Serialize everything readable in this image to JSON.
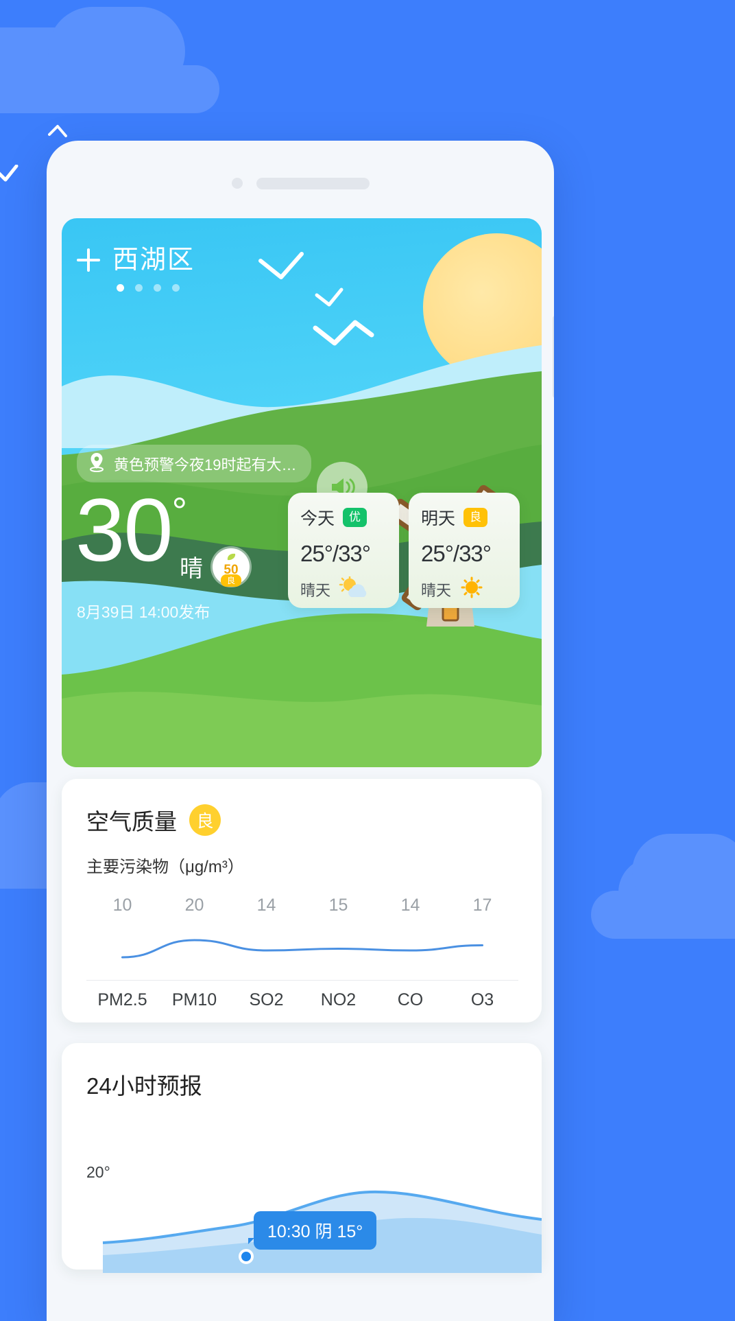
{
  "background": {
    "brand_blue": "#3d7efc",
    "cloud_blue": "#5a91fd"
  },
  "hero": {
    "add_icon": "plus-icon",
    "city": "西湖区",
    "page_dots": 4,
    "active_dot": 0,
    "voice_icon": "speaker-bubble-icon",
    "alert": {
      "icon": "location-pin-icon",
      "text": "黄色预警今夜19时起有大…"
    },
    "temperature": "30",
    "degree": "°",
    "condition": "晴",
    "aqi_badge": {
      "value": "50",
      "level": "良",
      "leaf_icon": "leaf-icon",
      "value_color": "#f0a500",
      "level_bg": "#ffc107"
    },
    "publish": "8月39日 14:00发布",
    "windmill_icon": "windmill-icon",
    "sun_icon": "sun-icon"
  },
  "forecast_cards": [
    {
      "day": "今天",
      "badge": "优",
      "badge_color": "#14c26a",
      "temp": "25°/33°",
      "desc": "晴天",
      "icon": "sun-behind-cloud-icon"
    },
    {
      "day": "明天",
      "badge": "良",
      "badge_color": "#ffc107",
      "temp": "25°/33°",
      "desc": "晴天",
      "icon": "sun-icon"
    }
  ],
  "air_quality": {
    "title": "空气质量",
    "level": "良",
    "level_color": "#ffd02e",
    "subtitle": "主要污染物（μg/m³）"
  },
  "chart_data": {
    "type": "line",
    "title": "主要污染物（μg/m³）",
    "categories": [
      "PM2.5",
      "PM10",
      "SO2",
      "NO2",
      "CO",
      "O3"
    ],
    "values": [
      10,
      20,
      14,
      15,
      14,
      17
    ],
    "value_labels": [
      "10",
      "20",
      "14",
      "15",
      "14",
      "17"
    ],
    "xlabel": "",
    "ylabel": "μg/m³",
    "ylim": [
      0,
      24
    ],
    "grid": false,
    "legend": "none",
    "line_color": "#4a90e2"
  },
  "hourly": {
    "title": "24小时预报",
    "axis_label": "20°",
    "tooltip": "10:30 阴 15°",
    "line_color": "#2b8ae8"
  }
}
